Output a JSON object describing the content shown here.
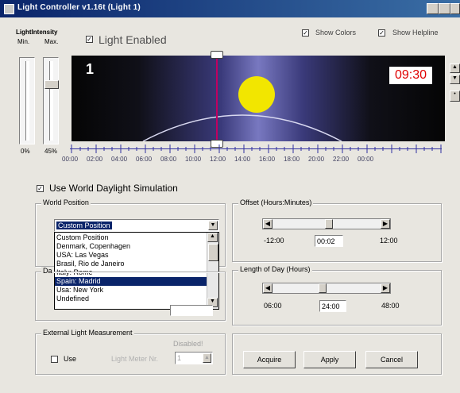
{
  "window": {
    "title": "Light Controller v1.16t  (Light 1)"
  },
  "intensity": {
    "label": "LightIntensity",
    "min_label": "Min.",
    "max_label": "Max.",
    "min_value": "0%",
    "max_value": "45%"
  },
  "light_enabled": {
    "label": "Light Enabled",
    "checked": true
  },
  "show_colors": {
    "label": "Show Colors",
    "checked": true
  },
  "show_helpline": {
    "label": "Show Helpline",
    "checked": true
  },
  "light_number": "1",
  "time_display": "09:30",
  "timeline_labels": [
    "00:00",
    "02:00",
    "04:00",
    "06:00",
    "08:00",
    "10:00",
    "12:00",
    "14:00",
    "16:00",
    "18:00",
    "20:00",
    "22:00",
    "00:00"
  ],
  "daylight_sim": {
    "label": "Use World Daylight Simulation",
    "checked": true
  },
  "world_position": {
    "legend": "World Position",
    "selected": "Custom Position",
    "options": [
      "Custom Position",
      "Denmark, Copenhagen",
      "USA: Las Vegas",
      "Brasil, Rio de Janeiro",
      "Italy: Rome",
      "Spain: Madrid",
      "Usa: New York",
      "Undefined"
    ],
    "highlighted": "Spain: Madrid"
  },
  "date_label": "Da",
  "offset": {
    "legend": "Offset (Hours:Minutes)",
    "min": "-12:00",
    "max": "12:00",
    "value": "00:02"
  },
  "length_of_day": {
    "legend": "Length of Day (Hours)",
    "min": "06:00",
    "max": "48:00",
    "value": "24:00"
  },
  "external": {
    "legend": "External Light Measurement",
    "use_label": "Use",
    "disabled_label": "Disabled!",
    "sensor_label": "Light Meter Nr.",
    "sensor_value": "1"
  },
  "buttons": {
    "acquire": "Acquire",
    "apply": "Apply",
    "cancel": "Cancel"
  },
  "colors": {
    "title_bar": "#0a246a",
    "time_red": "#e00000",
    "sun": "#f2e600",
    "selection": "#0a246a",
    "helpline": "#c00060"
  }
}
